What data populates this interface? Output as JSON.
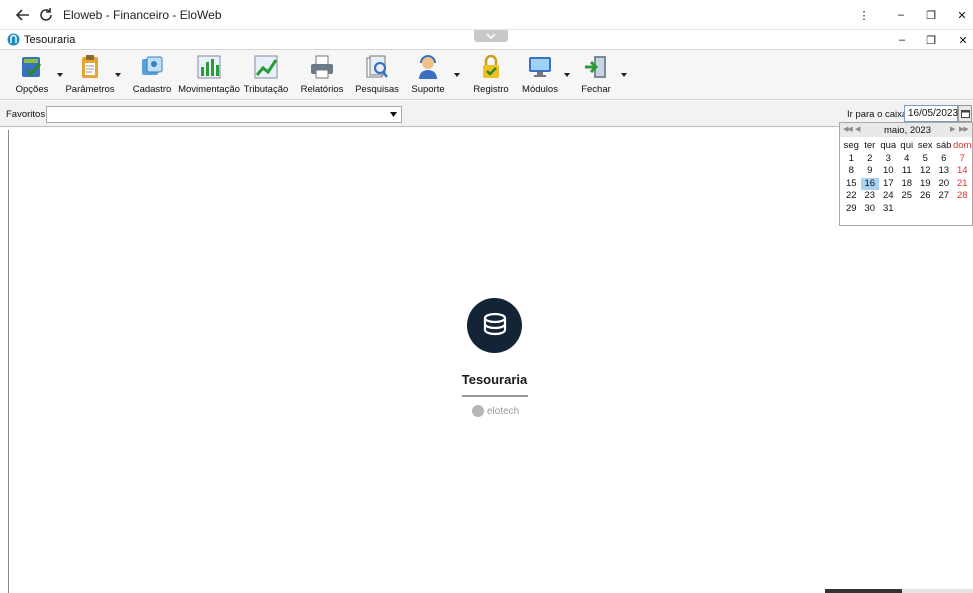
{
  "browser": {
    "title": "Eloweb - Financeiro - EloWeb",
    "menu_glyph": "⋮",
    "minimize_glyph": "–",
    "restore_glyph": "❐",
    "close_glyph": "✕"
  },
  "app": {
    "title": "Tesouraria",
    "minimize_glyph": "–",
    "restore_glyph": "❐",
    "close_glyph": "✕"
  },
  "toolbar": {
    "items": [
      {
        "label": "Opções",
        "icon": "options-icon"
      },
      {
        "label": "Parâmetros",
        "icon": "clipboard-icon"
      },
      {
        "label": "Cadastro",
        "icon": "register-icon"
      },
      {
        "label": "Movimentação",
        "icon": "bar-chart-icon"
      },
      {
        "label": "Tributação",
        "icon": "line-chart-icon"
      },
      {
        "label": "Relatórios",
        "icon": "printer-icon"
      },
      {
        "label": "Pesquisas",
        "icon": "search-docs-icon"
      },
      {
        "label": "Suporte",
        "icon": "support-icon"
      },
      {
        "label": "Registro",
        "icon": "lock-icon"
      },
      {
        "label": "Módulos",
        "icon": "monitor-icon"
      },
      {
        "label": "Fechar",
        "icon": "exit-icon"
      }
    ]
  },
  "favorites": {
    "label": "Favoritos",
    "value": ""
  },
  "caixa": {
    "label": "Ir para o caixa",
    "date": "16/05/2023"
  },
  "calendar": {
    "month_label": "maio, 2023",
    "weekdays": [
      "seg",
      "ter",
      "qua",
      "qui",
      "sex",
      "sáb",
      "dom"
    ],
    "weeks": [
      [
        "1",
        "2",
        "3",
        "4",
        "5",
        "6",
        "7"
      ],
      [
        "8",
        "9",
        "10",
        "11",
        "12",
        "13",
        "14"
      ],
      [
        "15",
        "16",
        "17",
        "18",
        "19",
        "20",
        "21"
      ],
      [
        "22",
        "23",
        "24",
        "25",
        "26",
        "27",
        "28"
      ],
      [
        "29",
        "30",
        "31",
        "",
        "",
        "",
        ""
      ]
    ],
    "selected_day": "16",
    "sunday_color": "#e03030"
  },
  "center": {
    "title": "Tesouraria",
    "brand": "elotech",
    "logo_color": "#122436"
  }
}
